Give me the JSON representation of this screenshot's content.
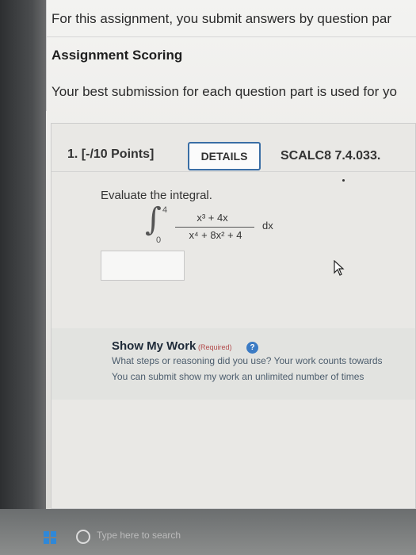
{
  "intro": {
    "info_line": "For this assignment, you submit answers by question par",
    "scoring_heading": "Assignment Scoring",
    "scoring_line": "Your best submission for each question part is used for yo"
  },
  "question": {
    "number_points": "1.  [-/10 Points]",
    "details_label": "DETAILS",
    "problem_id": "SCALC8 7.4.033.",
    "prompt": "Evaluate the integral.",
    "integral": {
      "upper_limit": "4",
      "lower_limit": "0",
      "numerator": "x³ + 4x",
      "denominator": "x⁴ + 8x² + 4",
      "differential": "dx"
    },
    "answer_value": ""
  },
  "show_my_work": {
    "title": "Show My Work",
    "required_label": "(Required)",
    "help_symbol": "?",
    "question_text": "What steps or reasoning did you use? Your work counts towards",
    "limit_text": "You can submit show my work an unlimited number of times"
  },
  "taskbar": {
    "search_placeholder": "Type here to search"
  },
  "icons": {
    "start": "windows-start-icon",
    "search": "search-icon",
    "help": "help-icon",
    "cursor": "mouse-cursor-icon"
  },
  "colors": {
    "details_border": "#3a6ea5",
    "help_icon": "#3b7bc4",
    "required_text": "#b24b4b"
  }
}
